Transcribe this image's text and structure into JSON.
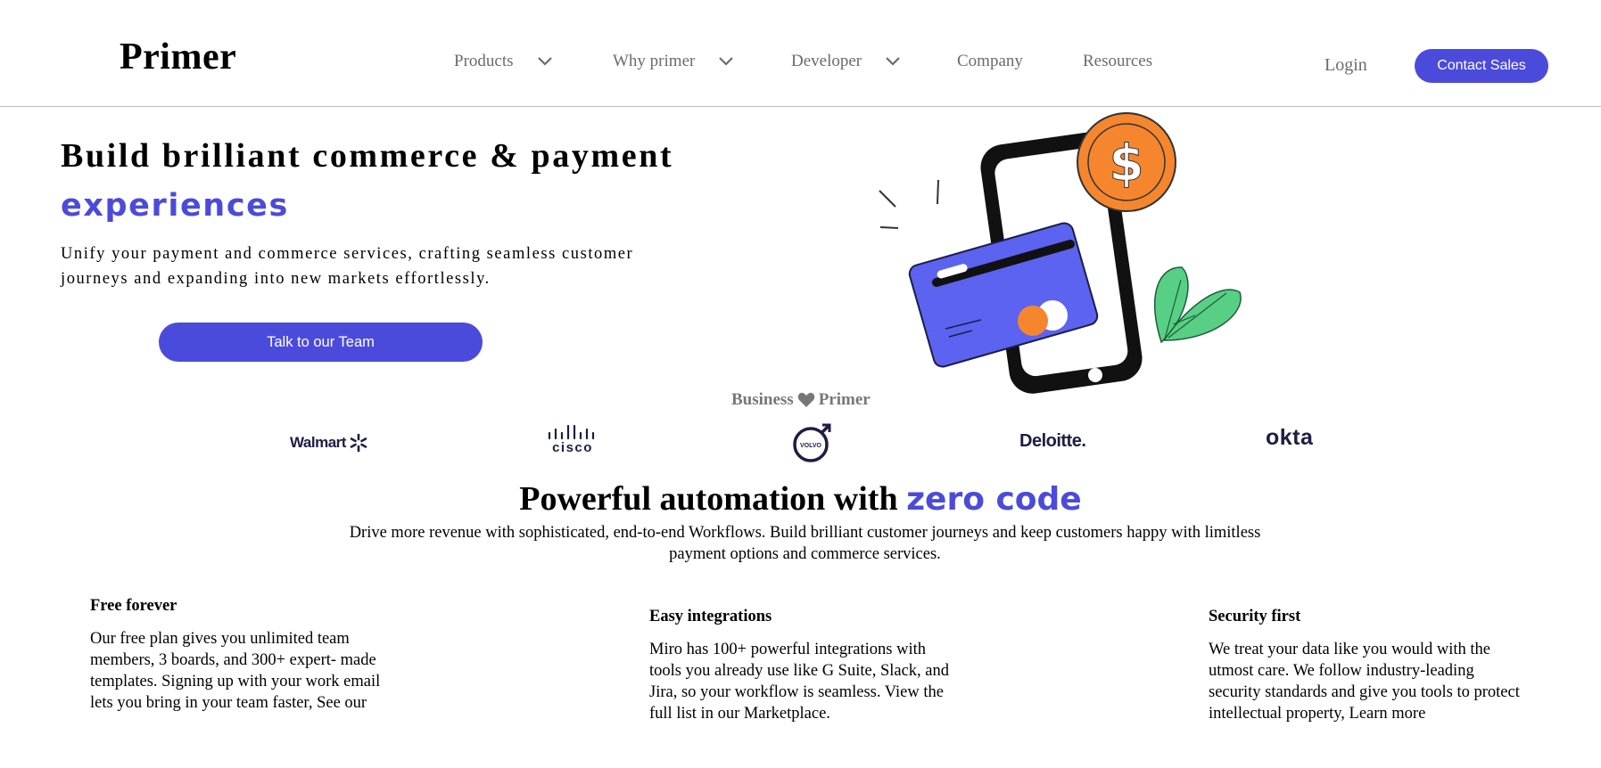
{
  "nav": {
    "logo": "Primer",
    "items": [
      {
        "label": "Products",
        "has_dropdown": true
      },
      {
        "label": "Why primer",
        "has_dropdown": true
      },
      {
        "label": "Developer",
        "has_dropdown": true
      },
      {
        "label": "Company",
        "has_dropdown": false
      },
      {
        "label": "Resources",
        "has_dropdown": false
      }
    ],
    "login": "Login",
    "contact_sales": "Contact Sales"
  },
  "hero": {
    "title": "Build brilliant commerce & payment",
    "title_accent": "experiences",
    "subtitle": "Unify your payment and commerce services, crafting seamless customer journeys and expanding into new markets effortlessly.",
    "cta": "Talk to our Team",
    "illustration_icons": [
      "smartphone-icon",
      "dollar-coin-icon",
      "credit-card-icon",
      "leaf-icon"
    ]
  },
  "partners": {
    "left": "Business",
    "right": "Primer",
    "heart_icon": "heart-icon",
    "logos": [
      "Walmart",
      "cisco",
      "VOLVO",
      "Deloitte.",
      "okta"
    ]
  },
  "automation": {
    "title": "Powerful automation with ",
    "title_accent": "zero code",
    "subtitle": "Drive more revenue with sophisticated, end-to-end Workflows. Build brilliant customer journeys and keep customers happy with limitless payment options and commerce services."
  },
  "features": [
    {
      "title": "Free forever",
      "text": "Our free plan gives you unlimited team members, 3 boards, and 300+ expert- made templates. Signing up with your work email lets you bring in your team faster, See our"
    },
    {
      "title": "Easy integrations",
      "text": "Miro has 100+ powerful integrations with tools you already use like G Suite, Slack, and Jira, so your workflow is seamless. View the full list in our Marketplace."
    },
    {
      "title": "Security first",
      "text": "We treat your data like you would with the utmost care. We follow industry-leading security standards and give you tools to protect intellectual property, Learn more"
    }
  ],
  "colors": {
    "accent": "#4b4bdb",
    "nav_text": "#6b6b6b",
    "coin": "#f5862e",
    "card": "#5b63f0",
    "leaf": "#57cf84"
  }
}
